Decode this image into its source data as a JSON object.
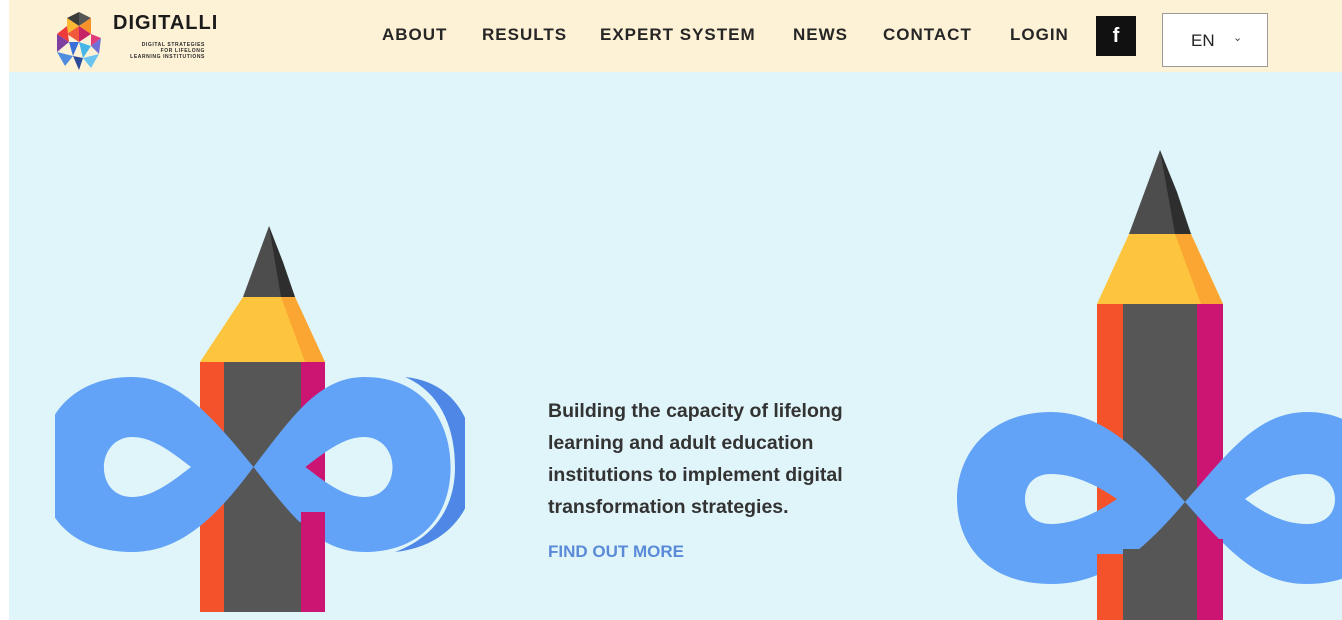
{
  "brand": {
    "name": "DIGITALLI",
    "tagline_line1": "DIGITAL STRATEGIES",
    "tagline_line2": "FOR LIFELONG",
    "tagline_line3": "LEARNING INSTITUTIONS"
  },
  "nav": {
    "about": "ABOUT",
    "results": "RESULTS",
    "expert_system": "EXPERT SYSTEM",
    "news": "NEWS",
    "contact": "CONTACT",
    "login": "LOGIN"
  },
  "social": {
    "facebook_glyph": "f"
  },
  "language": {
    "selected": "EN",
    "chevron": "⌄"
  },
  "hero": {
    "heading": "Building the capacity of lifelong learning and adult education institutions to implement digital transformation strategies.",
    "cta": "FIND OUT MORE"
  },
  "colors": {
    "header_bg": "#fdf1d6",
    "hero_bg": "#e0f5f9",
    "cta": "#5b8bd8",
    "infinity_blue": "#63a3f7",
    "pencil_gray": "#555555",
    "pencil_orange": "#f4522a",
    "pencil_magenta": "#cc1573",
    "pencil_yellow": "#fdc53e"
  }
}
